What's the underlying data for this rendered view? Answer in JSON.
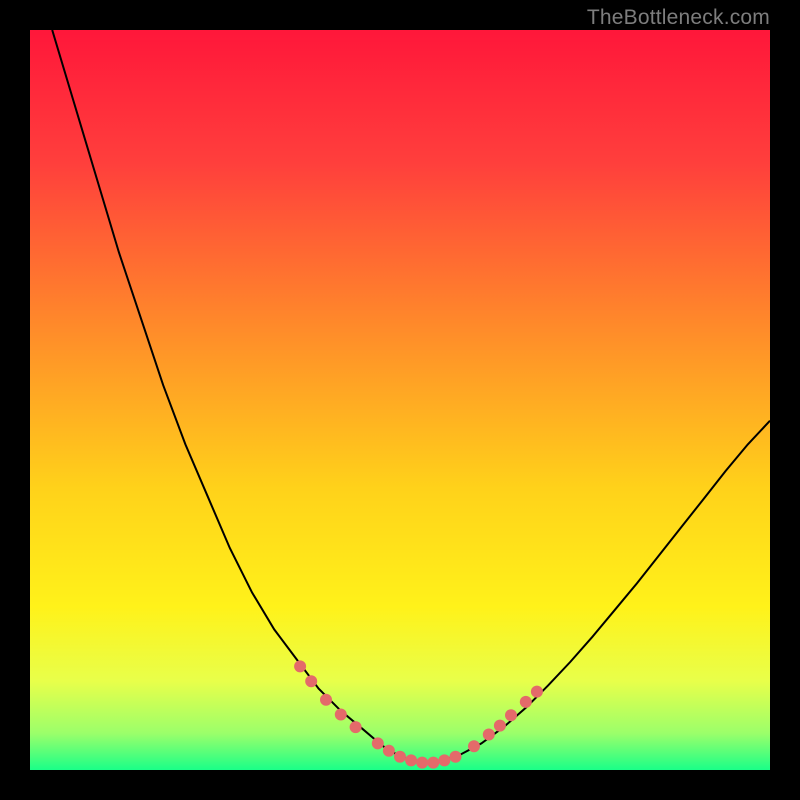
{
  "watermark": "TheBottleneck.com",
  "colors": {
    "frame_bg": "#000000",
    "curve_stroke": "#000000",
    "marker_fill": "#e46a6a",
    "marker_stroke": "#8b2f2f",
    "gradient_stops": [
      {
        "offset": "0%",
        "color": "#ff173a"
      },
      {
        "offset": "18%",
        "color": "#ff3f3c"
      },
      {
        "offset": "40%",
        "color": "#ff8a2a"
      },
      {
        "offset": "62%",
        "color": "#ffd21a"
      },
      {
        "offset": "78%",
        "color": "#fff21a"
      },
      {
        "offset": "88%",
        "color": "#e8ff4a"
      },
      {
        "offset": "95%",
        "color": "#9cff6a"
      },
      {
        "offset": "100%",
        "color": "#1aff88"
      }
    ]
  },
  "chart_data": {
    "type": "line",
    "title": "",
    "xlabel": "",
    "ylabel": "",
    "xlim": [
      0,
      100
    ],
    "ylim": [
      0,
      100
    ],
    "grid": false,
    "legend": false,
    "x": [
      3,
      6,
      9,
      12,
      15,
      18,
      21,
      24,
      27,
      30,
      33,
      36,
      39,
      42,
      45,
      47,
      48,
      49,
      50,
      51,
      52,
      53,
      54,
      55,
      56,
      58,
      61,
      64,
      67,
      70,
      73,
      76,
      79,
      82,
      85,
      88,
      91,
      94,
      97,
      100
    ],
    "values": [
      100,
      90,
      80,
      70,
      61,
      52,
      44,
      37,
      30,
      24,
      19,
      15,
      11,
      8,
      5.5,
      3.8,
      3.0,
      2.4,
      1.9,
      1.5,
      1.2,
      1.0,
      1.0,
      1.1,
      1.4,
      2.0,
      3.6,
      5.8,
      8.4,
      11.4,
      14.6,
      18.0,
      21.6,
      25.2,
      29.0,
      32.8,
      36.6,
      40.4,
      44.0,
      47.2
    ],
    "markers": [
      {
        "x": 36.5,
        "y": 14.0
      },
      {
        "x": 38.0,
        "y": 12.0
      },
      {
        "x": 40.0,
        "y": 9.5
      },
      {
        "x": 42.0,
        "y": 7.5
      },
      {
        "x": 44.0,
        "y": 5.8
      },
      {
        "x": 47.0,
        "y": 3.6
      },
      {
        "x": 48.5,
        "y": 2.6
      },
      {
        "x": 50.0,
        "y": 1.8
      },
      {
        "x": 51.5,
        "y": 1.3
      },
      {
        "x": 53.0,
        "y": 1.0
      },
      {
        "x": 54.5,
        "y": 1.0
      },
      {
        "x": 56.0,
        "y": 1.3
      },
      {
        "x": 57.5,
        "y": 1.8
      },
      {
        "x": 60.0,
        "y": 3.2
      },
      {
        "x": 62.0,
        "y": 4.8
      },
      {
        "x": 63.5,
        "y": 6.0
      },
      {
        "x": 65.0,
        "y": 7.4
      },
      {
        "x": 67.0,
        "y": 9.2
      },
      {
        "x": 68.5,
        "y": 10.6
      }
    ],
    "marker_radius": 6
  }
}
